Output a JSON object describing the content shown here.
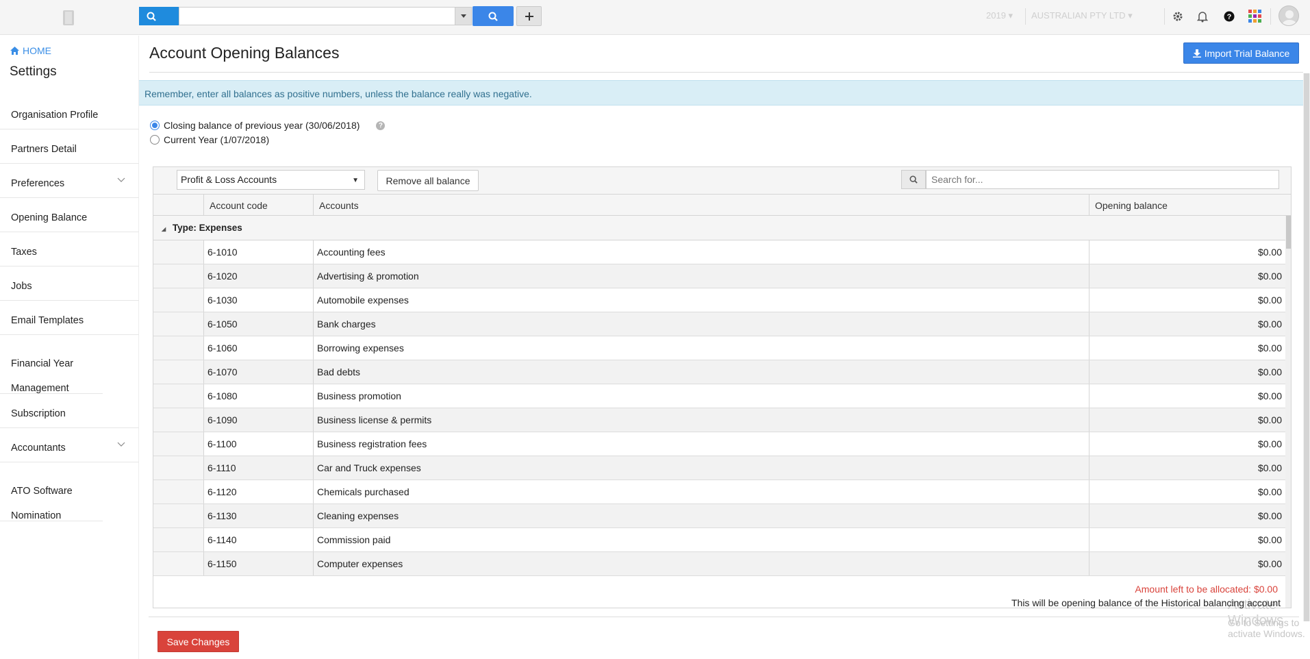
{
  "topbar": {
    "logo_icon": "book-logo-icon",
    "search_placeholder": "",
    "year": "2019",
    "organisation": "AUSTRALIAN PTY LTD",
    "icons": [
      "gear-icon",
      "bell-icon",
      "help-icon",
      "apps-grid-icon",
      "user-avatar-icon"
    ]
  },
  "sidebar": {
    "home_label": "HOME",
    "title": "Settings",
    "items": [
      {
        "label": "Organisation Profile"
      },
      {
        "label": "Partners Detail"
      },
      {
        "label": "Preferences"
      },
      {
        "label": "Opening Balance"
      },
      {
        "label": "Taxes"
      },
      {
        "label": "Jobs"
      },
      {
        "label": "Email Templates"
      },
      {
        "label": "Financial Year Management"
      },
      {
        "label": "Subscription"
      },
      {
        "label": "Accountants"
      },
      {
        "label": "ATO Software Nomination"
      }
    ]
  },
  "main": {
    "title": "Account Opening Balances",
    "import_label": "Import Trial Balance",
    "notice": "Remember, enter all balances as positive numbers, unless the balance really was negative.",
    "radio_1": "Closing balance of previous year (30/06/2018)",
    "radio_2": "Current Year (1/07/2018)",
    "help_glyph": "?"
  },
  "grid": {
    "account_filter": "Profit & Loss Accounts",
    "remove_label": "Remove all balance",
    "search_placeholder": "Search for...",
    "columns": [
      "Account code",
      "Accounts",
      "Opening balance"
    ],
    "group_label": "Type: Expenses",
    "rows": [
      {
        "code": "6-1010",
        "name": "Accounting fees",
        "balance": "$0.00"
      },
      {
        "code": "6-1020",
        "name": "Advertising & promotion",
        "balance": "$0.00"
      },
      {
        "code": "6-1030",
        "name": "Automobile expenses",
        "balance": "$0.00"
      },
      {
        "code": "6-1050",
        "name": "Bank charges",
        "balance": "$0.00"
      },
      {
        "code": "6-1060",
        "name": "Borrowing expenses",
        "balance": "$0.00"
      },
      {
        "code": "6-1070",
        "name": "Bad debts",
        "balance": "$0.00"
      },
      {
        "code": "6-1080",
        "name": "Business promotion",
        "balance": "$0.00"
      },
      {
        "code": "6-1090",
        "name": "Business license & permits",
        "balance": "$0.00"
      },
      {
        "code": "6-1100",
        "name": "Business registration fees",
        "balance": "$0.00"
      },
      {
        "code": "6-1110",
        "name": "Car and Truck expenses",
        "balance": "$0.00"
      },
      {
        "code": "6-1120",
        "name": "Chemicals purchased",
        "balance": "$0.00"
      },
      {
        "code": "6-1130",
        "name": "Cleaning expenses",
        "balance": "$0.00"
      },
      {
        "code": "6-1140",
        "name": "Commission paid",
        "balance": "$0.00"
      },
      {
        "code": "6-1150",
        "name": "Computer expenses",
        "balance": "$0.00"
      }
    ]
  },
  "footer": {
    "amount_left": "Amount left to be allocated: $0.00",
    "historical_note": "This will be opening balance of the Historical balancing account",
    "save_label": "Save Changes",
    "watermark_title": "Activate Windows",
    "watermark_sub": "Go to Settings to activate Windows."
  },
  "colors": {
    "primary": "#3b86e8",
    "search_blue": "#1f8bdd",
    "danger": "#d9433b",
    "notice_bg": "#d9eef6",
    "notice_text": "#31708f"
  }
}
